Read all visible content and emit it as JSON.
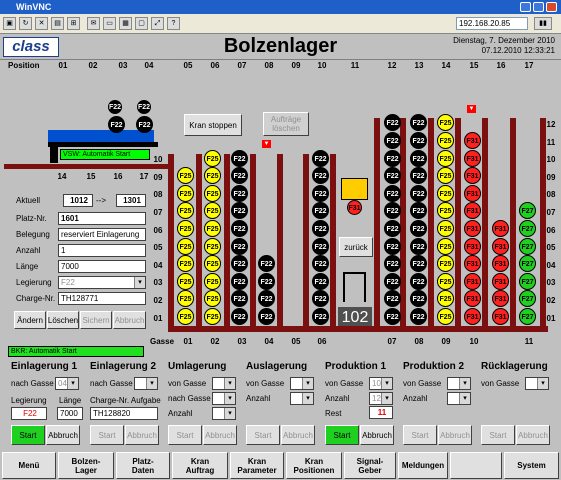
{
  "window": {
    "title": "WinVNC",
    "host": "192.168.20.85"
  },
  "header": {
    "logo": "class",
    "title": "Bolzenlager",
    "date": "Dienstag, 7. Dezember 2010",
    "datetime": "07.12.2010   12:33:21"
  },
  "position_label": "Position",
  "top_positions": [
    "01",
    "02",
    "03",
    "04",
    "05",
    "06",
    "07",
    "08",
    "09",
    "10",
    "11",
    "12",
    "13",
    "14",
    "15",
    "16",
    "17"
  ],
  "gasse_label": "Gasse",
  "gasse_positions": [
    "01",
    "02",
    "03",
    "04",
    "05",
    "06",
    "07",
    "08",
    "09",
    "10",
    "11"
  ],
  "level_labels": [
    "12",
    "11",
    "10",
    "09",
    "08",
    "07",
    "06",
    "05",
    "04",
    "03",
    "02",
    "01"
  ],
  "crane": {
    "status": "VSW: Automatik Start",
    "from": "14",
    "p2": "15",
    "p3": "16",
    "p4": "17",
    "coils": [
      "F22",
      "F22",
      "F22",
      "F22"
    ]
  },
  "buttons": {
    "kran_stoppen": "Kran stoppen",
    "auftraege_loeschen": "Aufträge löschen",
    "zurueck": "zurück"
  },
  "crane_display": "102",
  "lift_coil": "F31",
  "detail": {
    "aktuell_label": "Aktuell",
    "aktuell_from": "1012",
    "arrow": "-->",
    "aktuell_to": "1301",
    "platz_label": "Platz-Nr.",
    "platz": "1601",
    "belegung_label": "Belegung",
    "belegung": "reserviert Einlagerung",
    "anzahl_label": "Anzahl",
    "anzahl": "1",
    "laenge_label": "Länge",
    "laenge": "7000",
    "legierung_label": "Legierung",
    "legierung": "F22",
    "charge_label": "Charge-Nr.",
    "charge": "TH128771",
    "btn_aendern": "Ändern",
    "btn_loeschen": "Löschen",
    "btn_sichern": "Sichern",
    "btn_abbruch": "Abbruch"
  },
  "status_bar": "BKR: Automatik Start",
  "sections": {
    "ein1": {
      "title": "Einlagerung 1",
      "nach_gasse": "nach Gasse",
      "gasse": "04",
      "legierung": "Legierung",
      "laenge": "Länge",
      "leg_val": "F22",
      "len_val": "7000",
      "start": "Start",
      "abbruch": "Abbruch"
    },
    "ein2": {
      "title": "Einlagerung 2",
      "nach_gasse": "nach Gasse",
      "charge_label": "Charge-Nr. Aufgabe",
      "charge": "TH128820",
      "start": "Start",
      "abbruch": "Abbruch"
    },
    "uml": {
      "title": "Umlagerung",
      "von": "von Gasse",
      "nach": "nach Gasse",
      "anzahl": "Anzahl",
      "start": "Start",
      "abbruch": "Abbruch"
    },
    "aus": {
      "title": "Auslagerung",
      "von": "von Gasse",
      "anzahl": "Anzahl",
      "start": "Start",
      "abbruch": "Abbruch"
    },
    "prod1": {
      "title": "Produktion 1",
      "von": "von Gasse",
      "gasse": "10",
      "anzahl": "Anzahl",
      "anz": "12",
      "rest": "Rest",
      "rest_val": "11",
      "start": "Start",
      "abbruch": "Abbruch"
    },
    "prod2": {
      "title": "Produktion 2",
      "von": "von Gasse",
      "anzahl": "Anzahl",
      "start": "Start",
      "abbruch": "Abbruch"
    },
    "rueck": {
      "title": "Rücklagerung",
      "von": "von Gasse",
      "start": "Start",
      "abbruch": "Abbruch"
    }
  },
  "nav": [
    "Menü",
    "Bolzen-\nLager",
    "Platz-\nDaten",
    "Kran\nAuftrag",
    "Kran\nParameter",
    "Kran\nPositionen",
    "Signal-\nGeber",
    "Meldungen",
    "",
    "System"
  ],
  "columns": [
    {
      "coils": [
        {
          "t": "F25",
          "c": "yel"
        },
        {
          "t": "F25",
          "c": "yel"
        },
        {
          "t": "F25",
          "c": "yel"
        },
        {
          "t": "F25",
          "c": "yel"
        },
        {
          "t": "F25",
          "c": "yel"
        },
        {
          "t": "F25",
          "c": "yel"
        },
        {
          "t": "F25",
          "c": "yel"
        },
        {
          "t": "F25",
          "c": "yel"
        },
        {
          "t": "F25",
          "c": "yel"
        }
      ]
    },
    {
      "coils": [
        {
          "t": "F25",
          "c": "yel"
        },
        {
          "t": "F25",
          "c": "yel"
        },
        {
          "t": "F25",
          "c": "yel"
        },
        {
          "t": "F25",
          "c": "yel"
        },
        {
          "t": "F25",
          "c": "yel"
        },
        {
          "t": "F25",
          "c": "yel"
        },
        {
          "t": "F25",
          "c": "yel"
        },
        {
          "t": "F25",
          "c": "yel"
        },
        {
          "t": "F25",
          "c": "yel"
        },
        {
          "t": "F25",
          "c": "yel"
        }
      ]
    },
    {
      "coils": [
        {
          "t": "F22",
          "c": "blk"
        },
        {
          "t": "F22",
          "c": "blk"
        },
        {
          "t": "F22",
          "c": "blk"
        },
        {
          "t": "F22",
          "c": "blk"
        },
        {
          "t": "F22",
          "c": "blk"
        },
        {
          "t": "F22",
          "c": "blk"
        },
        {
          "t": "F22",
          "c": "blk"
        },
        {
          "t": "F22",
          "c": "blk"
        },
        {
          "t": "F22",
          "c": "blk"
        },
        {
          "t": "F22",
          "c": "blk"
        }
      ]
    },
    {
      "coils": [
        {
          "t": "F22",
          "c": "blk"
        },
        {
          "t": "F22",
          "c": "blk"
        },
        {
          "t": "F22",
          "c": "blk"
        },
        {
          "t": "F22",
          "c": "blk"
        }
      ]
    },
    {
      "coils": []
    },
    {
      "coils": [
        {
          "t": "F22",
          "c": "blk"
        },
        {
          "t": "F22",
          "c": "blk"
        },
        {
          "t": "F22",
          "c": "blk"
        },
        {
          "t": "F22",
          "c": "blk"
        },
        {
          "t": "F22",
          "c": "blk"
        },
        {
          "t": "F22",
          "c": "blk"
        },
        {
          "t": "F22",
          "c": "blk"
        },
        {
          "t": "F22",
          "c": "blk"
        },
        {
          "t": "F22",
          "c": "blk"
        },
        {
          "t": "F22",
          "c": "blk"
        }
      ]
    },
    {
      "coils": [
        {
          "t": "F22",
          "c": "blk"
        },
        {
          "t": "F22",
          "c": "blk"
        },
        {
          "t": "F22",
          "c": "blk"
        },
        {
          "t": "F22",
          "c": "blk"
        },
        {
          "t": "F22",
          "c": "blk"
        },
        {
          "t": "F22",
          "c": "blk"
        },
        {
          "t": "F22",
          "c": "blk"
        },
        {
          "t": "F22",
          "c": "blk"
        },
        {
          "t": "F22",
          "c": "blk"
        },
        {
          "t": "F22",
          "c": "blk"
        },
        {
          "t": "F22",
          "c": "blk"
        },
        {
          "t": "F22",
          "c": "blk"
        }
      ]
    },
    {
      "coils": [
        {
          "t": "F22",
          "c": "blk"
        },
        {
          "t": "F22",
          "c": "blk"
        },
        {
          "t": "F22",
          "c": "blk"
        },
        {
          "t": "F22",
          "c": "blk"
        },
        {
          "t": "F22",
          "c": "blk"
        },
        {
          "t": "F22",
          "c": "blk"
        },
        {
          "t": "F22",
          "c": "blk"
        },
        {
          "t": "F22",
          "c": "blk"
        },
        {
          "t": "F22",
          "c": "blk"
        },
        {
          "t": "F22",
          "c": "blk"
        },
        {
          "t": "F22",
          "c": "blk"
        },
        {
          "t": "F22",
          "c": "blk"
        }
      ]
    },
    {
      "coils": [
        {
          "t": "F25",
          "c": "yel"
        },
        {
          "t": "F25",
          "c": "yel"
        },
        {
          "t": "F25",
          "c": "yel"
        },
        {
          "t": "F25",
          "c": "yel"
        },
        {
          "t": "F25",
          "c": "yel"
        },
        {
          "t": "F25",
          "c": "yel"
        },
        {
          "t": "F25",
          "c": "yel"
        },
        {
          "t": "F25",
          "c": "yel"
        },
        {
          "t": "F25",
          "c": "yel"
        },
        {
          "t": "F25",
          "c": "yel"
        },
        {
          "t": "F25",
          "c": "yel"
        },
        {
          "t": "F25",
          "c": "yel"
        }
      ]
    },
    {
      "coils": [
        {
          "t": "F31",
          "c": "red"
        },
        {
          "t": "F31",
          "c": "red"
        },
        {
          "t": "F31",
          "c": "red"
        },
        {
          "t": "F31",
          "c": "red"
        },
        {
          "t": "F31",
          "c": "red"
        },
        {
          "t": "F31",
          "c": "red"
        },
        {
          "t": "F31",
          "c": "red"
        },
        {
          "t": "F31",
          "c": "red"
        },
        {
          "t": "F31",
          "c": "red"
        },
        {
          "t": "F31",
          "c": "red"
        },
        {
          "t": "F31",
          "c": "red"
        }
      ]
    },
    {
      "coils": [
        {
          "t": "F31",
          "c": "red"
        },
        {
          "t": "F31",
          "c": "red"
        },
        {
          "t": "F31",
          "c": "red"
        },
        {
          "t": "F31",
          "c": "red"
        },
        {
          "t": "F31",
          "c": "red"
        },
        {
          "t": "F31",
          "c": "red"
        }
      ]
    },
    {
      "coils": [
        {
          "t": "F27",
          "c": "grn"
        },
        {
          "t": "F27",
          "c": "grn"
        },
        {
          "t": "F27",
          "c": "grn"
        },
        {
          "t": "F27",
          "c": "grn"
        },
        {
          "t": "F27",
          "c": "grn"
        },
        {
          "t": "F27",
          "c": "grn"
        },
        {
          "t": "F27",
          "c": "grn"
        }
      ]
    }
  ]
}
